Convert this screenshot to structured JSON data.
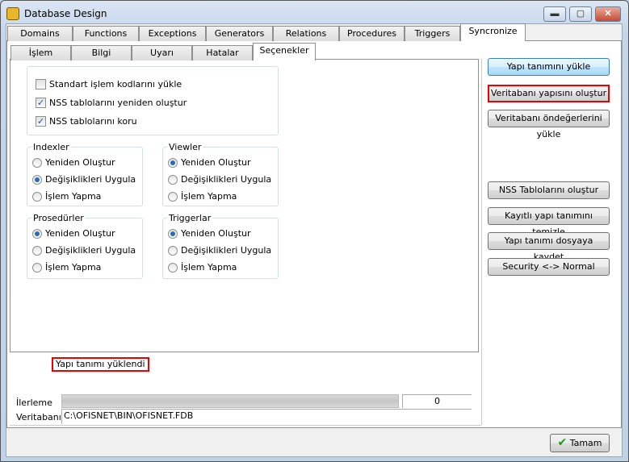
{
  "window": {
    "title": "Database Design",
    "minimize": "▬",
    "maximize": "▢",
    "close": "✕"
  },
  "tabs": [
    "Domains",
    "Functions",
    "Exceptions",
    "Generators",
    "Relations",
    "Procedures",
    "Triggers",
    "Syncronize"
  ],
  "subtabs": [
    "İşlem",
    "Bilgi",
    "Uyarı",
    "Hatalar",
    "Seçenekler"
  ],
  "options": {
    "checkboxes": [
      {
        "label": "Standart işlem kodlarını yükle",
        "checked": false
      },
      {
        "label": "NSS tablolarını yeniden oluştur",
        "checked": true
      },
      {
        "label": "NSS tablolarını koru",
        "checked": true
      }
    ],
    "groups": [
      {
        "title": "Indexler",
        "options": [
          "Yeniden Oluştur",
          "Değişiklikleri Uygula",
          "İşlem Yapma"
        ],
        "selected": 1
      },
      {
        "title": "Viewler",
        "options": [
          "Yeniden Oluştur",
          "Değişiklikleri Uygula",
          "İşlem Yapma"
        ],
        "selected": 0
      },
      {
        "title": "Prosedürler",
        "options": [
          "Yeniden Oluştur",
          "Değişiklikleri Uygula",
          "İşlem Yapma"
        ],
        "selected": 0
      },
      {
        "title": "Triggerlar",
        "options": [
          "Yeniden Oluştur",
          "Değişiklikleri Uygula",
          "İşlem Yapma"
        ],
        "selected": 0
      }
    ]
  },
  "actions": [
    "Yapı tanımını yükle",
    "Veritabanı yapısını oluştur",
    "Veritabanı öndeğerlerini yükle",
    "NSS Tablolarını oluştur",
    "Kayıtlı yapı tanımını temizle",
    "Yapı tanımı dosyaya kaydet",
    "Security <-> Normal"
  ],
  "status": {
    "message": "Yapı tanımı yüklendi",
    "progress_label": "İlerleme",
    "progress_value": "0",
    "progress_fraction": 1.0,
    "db_label": "Veritabanı",
    "db_path": "C:\\OFISNET\\BIN\\OFISNET.FDB"
  },
  "footer": {
    "ok_label": "Tamam",
    "ok_icon": "✔"
  }
}
